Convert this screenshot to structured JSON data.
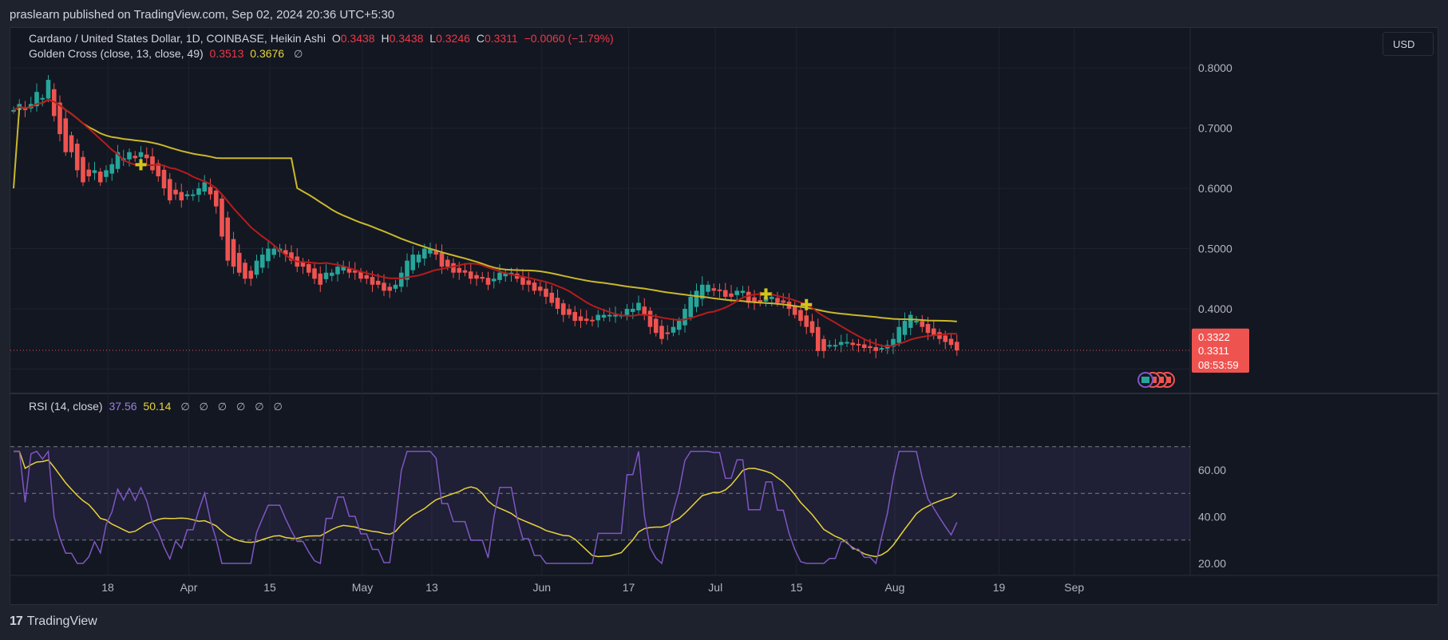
{
  "publisher": "praslearn published on TradingView.com, Sep 02, 2024 20:36 UTC+5:30",
  "brand": "TradingView",
  "brand_logo": "17",
  "currency_button": "USD",
  "legend": {
    "symbol": "Cardano / United States Dollar, 1D, COINBASE, Heikin Ashi",
    "open_label": "O",
    "open": "0.3438",
    "high_label": "H",
    "high": "0.3438",
    "low_label": "L",
    "low": "0.3246",
    "close_label": "C",
    "close": "0.3311",
    "change": "−0.0060 (−1.79%)",
    "indicator_name": "Golden Cross (close, 13, close, 49)",
    "indicator_fast": "0.3513",
    "indicator_slow": "0.3676",
    "eye_icon": "∅"
  },
  "rsi_legend": {
    "name": "RSI (14, close)",
    "value": "37.56",
    "ma_value": "50.14",
    "empty_values": [
      "∅",
      "∅",
      "∅",
      "∅",
      "∅",
      "∅"
    ]
  },
  "price_labels": {
    "sma13": "0.3322",
    "last": "0.3311",
    "countdown": "08:53:59"
  },
  "colors": {
    "up": "#26a69a",
    "down": "#ef5350",
    "fast_ma": "#b71c1c",
    "slow_ma": "#c9b82a",
    "rsi_line": "#7e57c2",
    "rsi_ma": "#e6d33b",
    "cross_marker": "#d4c41a",
    "background": "#131722",
    "grid": "#1e2230"
  },
  "chart_data": [
    {
      "type": "candlestick",
      "title": "Cardano / United States Dollar, 1D, COINBASE, Heikin Ashi",
      "x_tick_labels": [
        "18",
        "Apr",
        "15",
        "May",
        "13",
        "Jun",
        "17",
        "Jul",
        "15",
        "Aug",
        "19",
        "Sep"
      ],
      "y_tick_labels": [
        "0.8000",
        "0.7000",
        "0.6000",
        "0.5000",
        "0.4000"
      ],
      "ylim": [
        0.27,
        0.83
      ],
      "x_start": "2024-03-10",
      "series_markers": {
        "golden_cross_days": [
          "2024-04-01",
          "2024-07-18",
          "2024-07-25"
        ]
      },
      "closes": [
        0.73,
        0.74,
        0.73,
        0.74,
        0.76,
        0.75,
        0.78,
        0.72,
        0.69,
        0.66,
        0.66,
        0.63,
        0.61,
        0.62,
        0.63,
        0.61,
        0.63,
        0.64,
        0.66,
        0.65,
        0.66,
        0.65,
        0.66,
        0.65,
        0.63,
        0.62,
        0.6,
        0.58,
        0.59,
        0.58,
        0.59,
        0.59,
        0.6,
        0.61,
        0.59,
        0.57,
        0.52,
        0.48,
        0.47,
        0.46,
        0.45,
        0.45,
        0.48,
        0.49,
        0.5,
        0.5,
        0.5,
        0.49,
        0.48,
        0.47,
        0.47,
        0.46,
        0.45,
        0.44,
        0.46,
        0.46,
        0.47,
        0.47,
        0.46,
        0.46,
        0.45,
        0.45,
        0.44,
        0.44,
        0.43,
        0.43,
        0.44,
        0.46,
        0.48,
        0.49,
        0.49,
        0.5,
        0.5,
        0.49,
        0.47,
        0.47,
        0.46,
        0.46,
        0.46,
        0.45,
        0.45,
        0.45,
        0.44,
        0.45,
        0.46,
        0.46,
        0.46,
        0.45,
        0.44,
        0.44,
        0.43,
        0.43,
        0.42,
        0.41,
        0.4,
        0.39,
        0.39,
        0.38,
        0.38,
        0.38,
        0.38,
        0.39,
        0.39,
        0.39,
        0.39,
        0.39,
        0.4,
        0.4,
        0.41,
        0.39,
        0.37,
        0.36,
        0.35,
        0.36,
        0.37,
        0.38,
        0.4,
        0.42,
        0.43,
        0.44,
        0.44,
        0.43,
        0.43,
        0.42,
        0.42,
        0.43,
        0.43,
        0.41,
        0.41,
        0.41,
        0.42,
        0.42,
        0.41,
        0.41,
        0.4,
        0.39,
        0.38,
        0.37,
        0.36,
        0.33,
        0.33,
        0.34,
        0.34,
        0.345,
        0.345,
        0.34,
        0.34,
        0.335,
        0.335,
        0.33,
        0.335,
        0.34,
        0.35,
        0.37,
        0.38,
        0.39,
        0.38,
        0.37,
        0.36,
        0.355,
        0.35,
        0.345,
        0.34,
        0.331
      ],
      "sma13_last": 0.3513,
      "sma49_last": 0.3676,
      "last_price": 0.3311
    },
    {
      "type": "line",
      "title": "RSI (14, close)",
      "y_tick_labels": [
        "60.00",
        "40.00",
        "20.00"
      ],
      "ylim": [
        15,
        73
      ],
      "bands": {
        "upper": 70,
        "middle": 50,
        "lower": 30
      },
      "series": [
        {
          "name": "RSI (14, close)",
          "last": 37.56
        },
        {
          "name": "RSI MA",
          "last": 50.14
        }
      ]
    }
  ]
}
